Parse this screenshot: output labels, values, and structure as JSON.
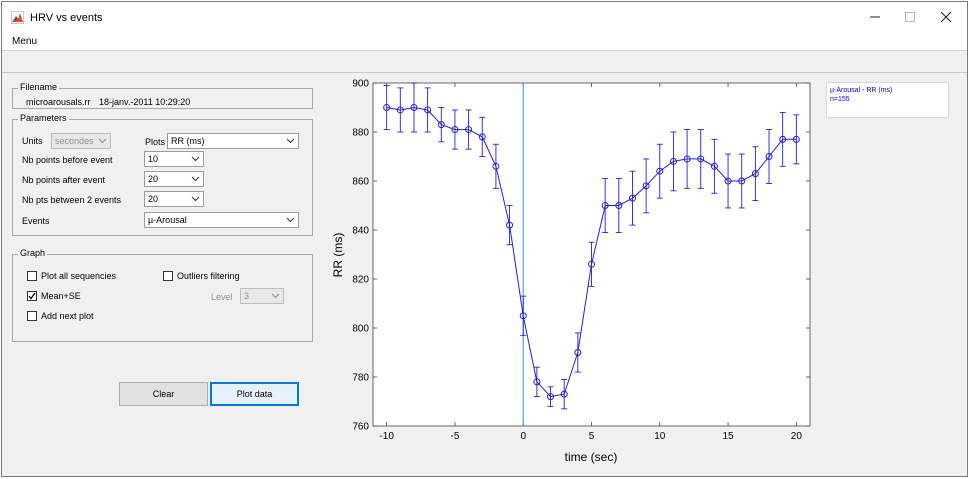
{
  "window": {
    "title": "HRV vs events"
  },
  "menu": {
    "label": "Menu"
  },
  "filename": {
    "title": "Filename",
    "file": "microarousals.rr",
    "date": "18-janv.-2011 10:29:20"
  },
  "parameters": {
    "title": "Parameters",
    "units_label": "Units",
    "units_value": "secondes",
    "plots_label": "Plots",
    "plots_value": "RR (ms)",
    "before_label": "Nb points before event",
    "before_value": "10",
    "after_label": "Nb points after event",
    "after_value": "20",
    "between_label": "Nb pts between 2 events",
    "between_value": "20",
    "events_label": "Events",
    "events_value": "µ-Arousal"
  },
  "graph": {
    "title": "Graph",
    "plot_all_label": "Plot all sequencies",
    "plot_all_checked": false,
    "outliers_label": "Outliers filtering",
    "outliers_checked": false,
    "mean_se_label": "Mean+SE",
    "mean_se_checked": true,
    "add_next_label": "Add next plot",
    "add_next_checked": false,
    "level_label": "Level",
    "level_value": "3"
  },
  "buttons": {
    "clear": "Clear",
    "plot": "Plot data"
  },
  "legend": {
    "line1": "µ-Arousal - RR (ms)",
    "line2": "n=155"
  },
  "colors": {
    "series": "#2222cc",
    "event_line": "#3a8fd9",
    "accent": "#0078d7"
  },
  "chart_data": {
    "type": "line",
    "xlabel": "time (sec)",
    "ylabel": "RR (ms)",
    "xlim": [
      -11,
      21
    ],
    "ylim": [
      760,
      900
    ],
    "xticks": [
      -10,
      -5,
      0,
      5,
      10,
      15,
      20
    ],
    "yticks": [
      760,
      780,
      800,
      820,
      840,
      860,
      880,
      900
    ],
    "event_x": 0,
    "grid": false,
    "series": [
      {
        "x": [
          -10,
          -9,
          -8,
          -7,
          -6,
          -5,
          -4,
          -3,
          -2,
          -1,
          0,
          1,
          2,
          3,
          4,
          5,
          6,
          7,
          8,
          9,
          10,
          11,
          12,
          13,
          14,
          15,
          16,
          17,
          18,
          19,
          20
        ],
        "y": [
          890,
          889,
          890,
          889,
          883,
          881,
          881,
          878,
          866,
          842,
          805,
          778,
          772,
          773,
          790,
          826,
          850,
          850,
          853,
          858,
          864,
          868,
          869,
          869,
          866,
          860,
          860,
          863,
          870,
          877,
          877
        ],
        "se": [
          9,
          9,
          10,
          9,
          7,
          8,
          8,
          8,
          9,
          8,
          8,
          6,
          4,
          6,
          8,
          9,
          11,
          11,
          11,
          11,
          11,
          12,
          12,
          12,
          11,
          11,
          11,
          11,
          11,
          11,
          10
        ]
      }
    ]
  }
}
